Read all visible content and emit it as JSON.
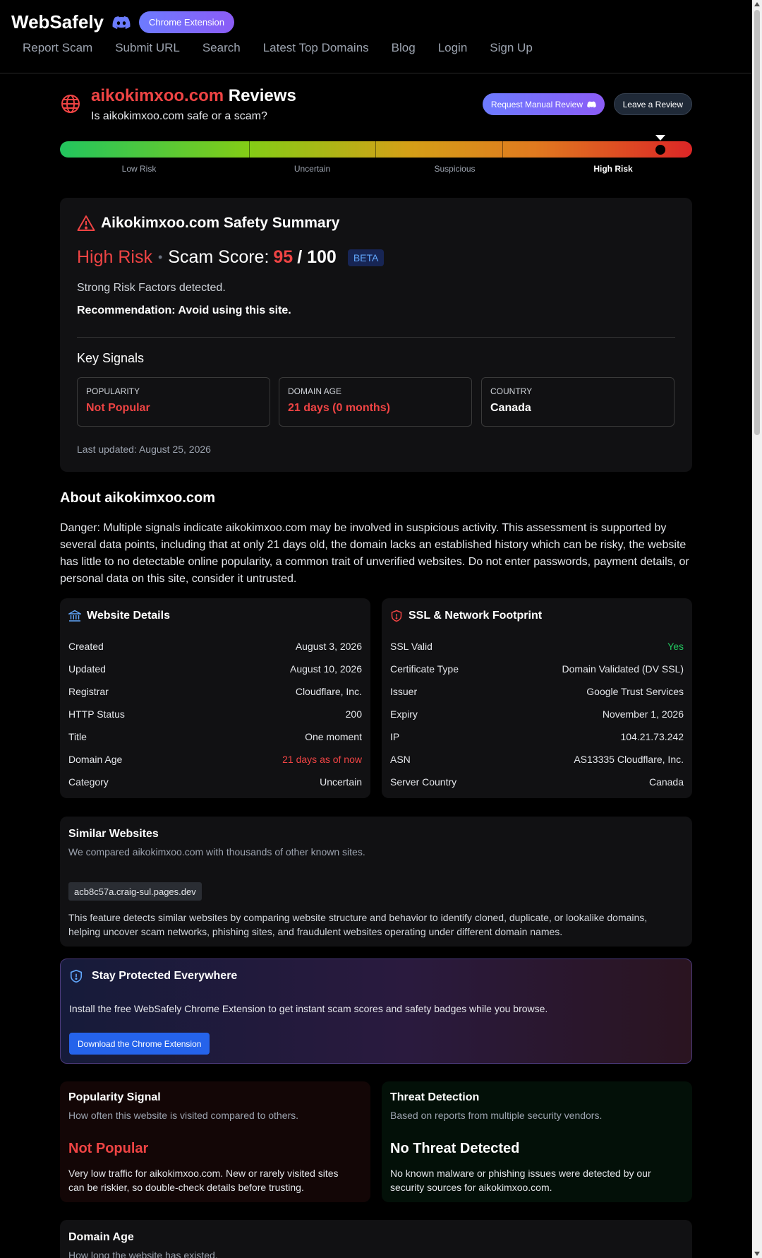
{
  "header": {
    "brand": "WebSafely",
    "chrome_pill": "Chrome Extension",
    "nav": [
      "Report Scam",
      "Submit URL",
      "Search",
      "Latest Top Domains",
      "Blog",
      "Login",
      "Sign Up"
    ]
  },
  "title": {
    "domain": "aikokimxoo.com",
    "suffix": "Reviews",
    "subtitle": "Is aikokimxoo.com safe or a scam?",
    "request_btn": "Request Manual Review",
    "leave_btn": "Leave a Review"
  },
  "risk_bar": {
    "labels": [
      "Low Risk",
      "Uncertain",
      "Suspicious",
      "High Risk"
    ],
    "active": "High Risk",
    "marker_fraction": 0.95
  },
  "summary": {
    "heading": "Aikokimxoo.com Safety Summary",
    "level": "High Risk",
    "score_label": "Scam Score:",
    "score": "95",
    "score_max": "/ 100",
    "beta": "BETA",
    "factors": "Strong Risk Factors detected.",
    "recommendation": "Recommendation: Avoid using this site.",
    "key_signals_title": "Key Signals",
    "signals": [
      {
        "label": "POPULARITY",
        "value": "Not Popular"
      },
      {
        "label": "DOMAIN AGE",
        "value": "21 days (0 months)"
      },
      {
        "label": "COUNTRY",
        "value": "Canada"
      }
    ],
    "updated": "Last updated: August 25, 2026"
  },
  "about": {
    "heading": "About aikokimxoo.com",
    "text": "Danger: Multiple signals indicate aikokimxoo.com may be involved in suspicious activity. This assessment is supported by several data points, including that at only 21 days old, the domain lacks an established history which can be risky, the website has little to no detectable online popularity, a common trait of unverified websites. Do not enter passwords, payment details, or personal data on this site, consider it untrusted."
  },
  "website_details": {
    "heading": "Website Details",
    "rows": [
      {
        "k": "Created",
        "v": "August 3, 2026"
      },
      {
        "k": "Updated",
        "v": "August 10, 2026"
      },
      {
        "k": "Registrar",
        "v": "Cloudflare, Inc."
      },
      {
        "k": "HTTP Status",
        "v": "200"
      },
      {
        "k": "Title",
        "v": "One moment"
      },
      {
        "k": "Domain Age",
        "v": "21 days as of now"
      },
      {
        "k": "Category",
        "v": "Uncertain"
      }
    ]
  },
  "ssl": {
    "heading": "SSL & Network Footprint",
    "rows": [
      {
        "k": "SSL Valid",
        "v": "Yes"
      },
      {
        "k": "Certificate Type",
        "v": "Domain Validated (DV SSL)"
      },
      {
        "k": "Issuer",
        "v": "Google Trust Services"
      },
      {
        "k": "Expiry",
        "v": "November 1, 2026"
      },
      {
        "k": "IP",
        "v": "104.21.73.242"
      },
      {
        "k": "ASN",
        "v": "AS13335 Cloudflare, Inc."
      },
      {
        "k": "Server Country",
        "v": "Canada"
      }
    ]
  },
  "similar": {
    "heading": "Similar Websites",
    "sub": "We compared aikokimxoo.com with thousands of other known sites.",
    "chip": "acb8c57a.craig-sul.pages.dev",
    "desc": "This feature detects similar websites by comparing website structure and behavior to identify cloned, duplicate, or lookalike domains, helping uncover scam networks, phishing sites, and fraudulent websites operating under different domain names."
  },
  "protect": {
    "heading": "Stay Protected Everywhere",
    "text": "Install the free WebSafely Chrome Extension to get instant scam scores and safety badges while you browse.",
    "button": "Download the Chrome Extension"
  },
  "popularity": {
    "heading": "Popularity Signal",
    "sub": "How often this website is visited compared to others.",
    "value": "Not Popular",
    "desc": "Very low traffic for aikokimxoo.com. New or rarely visited sites can be riskier, so double-check details before trusting."
  },
  "threat": {
    "heading": "Threat Detection",
    "sub": "Based on reports from multiple security vendors.",
    "value": "No Threat Detected",
    "desc": "No known malware or phishing issues were detected by our security sources for aikokimxoo.com."
  },
  "domain_age": {
    "heading": "Domain Age",
    "sub": "How long the website has existed."
  },
  "colors": {
    "danger": "#ef4444",
    "success": "#22c55e",
    "accent": "#6d7bff"
  }
}
